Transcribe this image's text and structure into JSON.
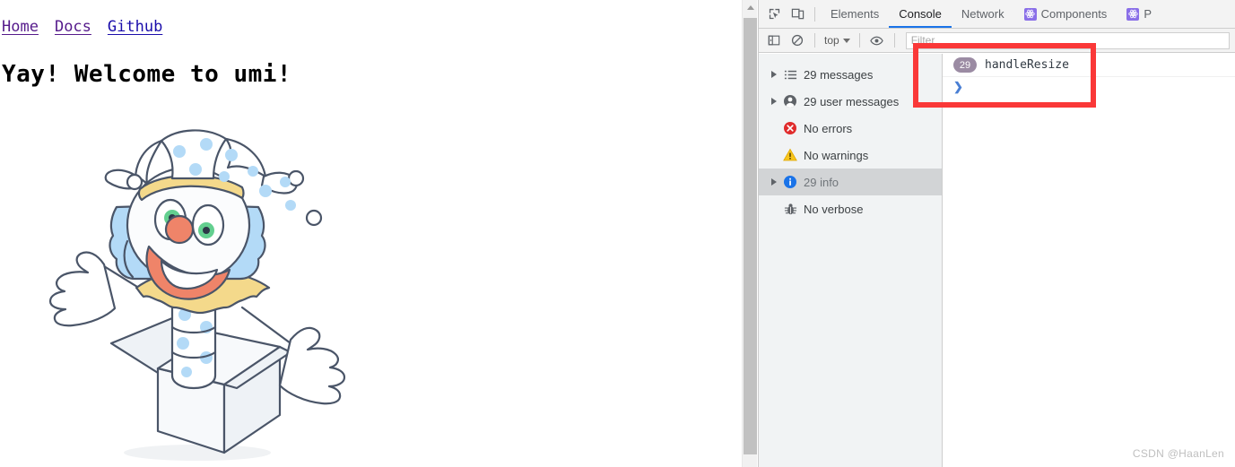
{
  "page": {
    "nav": [
      {
        "label": "Home",
        "state": "visited"
      },
      {
        "label": "Docs",
        "state": "visited"
      },
      {
        "label": "Github",
        "state": "unvisited"
      }
    ],
    "title": "Yay! Welcome to umi!",
    "illustration": "clown-jack-in-the-box-illustration"
  },
  "devtools": {
    "toolbar_icons": [
      {
        "name": "inspect-element-icon"
      },
      {
        "name": "device-toolbar-icon"
      }
    ],
    "tabs": [
      {
        "label": "Elements",
        "active": false,
        "icon": null
      },
      {
        "label": "Console",
        "active": true,
        "icon": null
      },
      {
        "label": "Network",
        "active": false,
        "icon": null
      },
      {
        "label": "Components",
        "active": false,
        "icon": "react-icon"
      },
      {
        "label": "P",
        "active": false,
        "icon": "react-icon"
      }
    ],
    "console_toolbar": {
      "sidebar_toggle_icon": "show-console-sidebar-icon",
      "clear_icon": "clear-console-icon",
      "context": "top",
      "eye_icon": "create-live-expression-icon",
      "filter_placeholder": "Filter"
    },
    "sidebar": [
      {
        "label": "29 messages",
        "icon": "list-icon",
        "expandable": true,
        "selected": false
      },
      {
        "label": "29 user messages",
        "icon": "person-icon",
        "expandable": true,
        "selected": false
      },
      {
        "label": "No errors",
        "icon": "error-icon",
        "expandable": false,
        "selected": false
      },
      {
        "label": "No warnings",
        "icon": "warning-icon",
        "expandable": false,
        "selected": false
      },
      {
        "label": "29 info",
        "icon": "info-icon",
        "expandable": true,
        "selected": true
      },
      {
        "label": "No verbose",
        "icon": "bug-icon",
        "expandable": false,
        "selected": false
      }
    ],
    "console_messages": [
      {
        "count": "29",
        "text": "handleResize"
      }
    ],
    "prompt_symbol": "❯"
  },
  "annotation": {
    "type": "red-rectangle-highlight",
    "color": "#fa3838"
  },
  "watermark": "CSDN @HaanLen"
}
